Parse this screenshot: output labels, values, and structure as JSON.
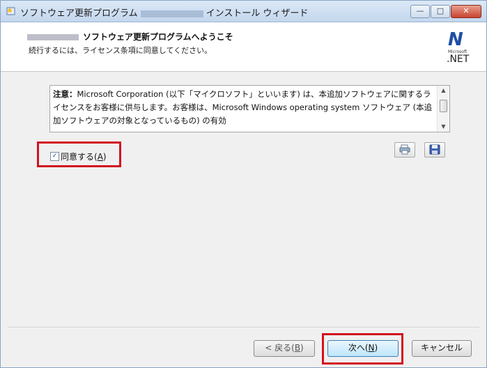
{
  "window": {
    "title_prefix": "ソフトウェア更新プログラム",
    "title_suffix": "インストール ウィザード",
    "minimize_glyph": "—",
    "maximize_glyph": "□",
    "close_glyph": "✕"
  },
  "header": {
    "title": "ソフトウェア更新プログラムへようこそ",
    "subtitle": "続行するには、ライセンス条項に同意してください。",
    "logo_mark": "N",
    "logo_brand": "Microsoft",
    "logo_text": ".NET"
  },
  "license": {
    "label": "注意：",
    "body": "Microsoft Corporation (以下「マイクロソフト」といいます) は、本追加ソフトウェアに関するライセンスをお客様に供与します。お客様は、Microsoft Windows operating system ソフトウェア (本追加ソフトウェアの対象となっているもの) の有効"
  },
  "agree": {
    "label_prefix": "同意する(",
    "label_key": "A",
    "label_suffix": ")",
    "checked": true,
    "check_glyph": "✓"
  },
  "icons": {
    "print": "print-icon",
    "save": "save-icon"
  },
  "buttons": {
    "back_prefix": "< 戻る(",
    "back_key": "B",
    "back_suffix": ")",
    "next_prefix": "次へ(",
    "next_key": "N",
    "next_suffix": ")",
    "cancel": "キャンセル"
  },
  "colors": {
    "highlight": "#d2131f",
    "net_blue": "#1e4fa6"
  }
}
